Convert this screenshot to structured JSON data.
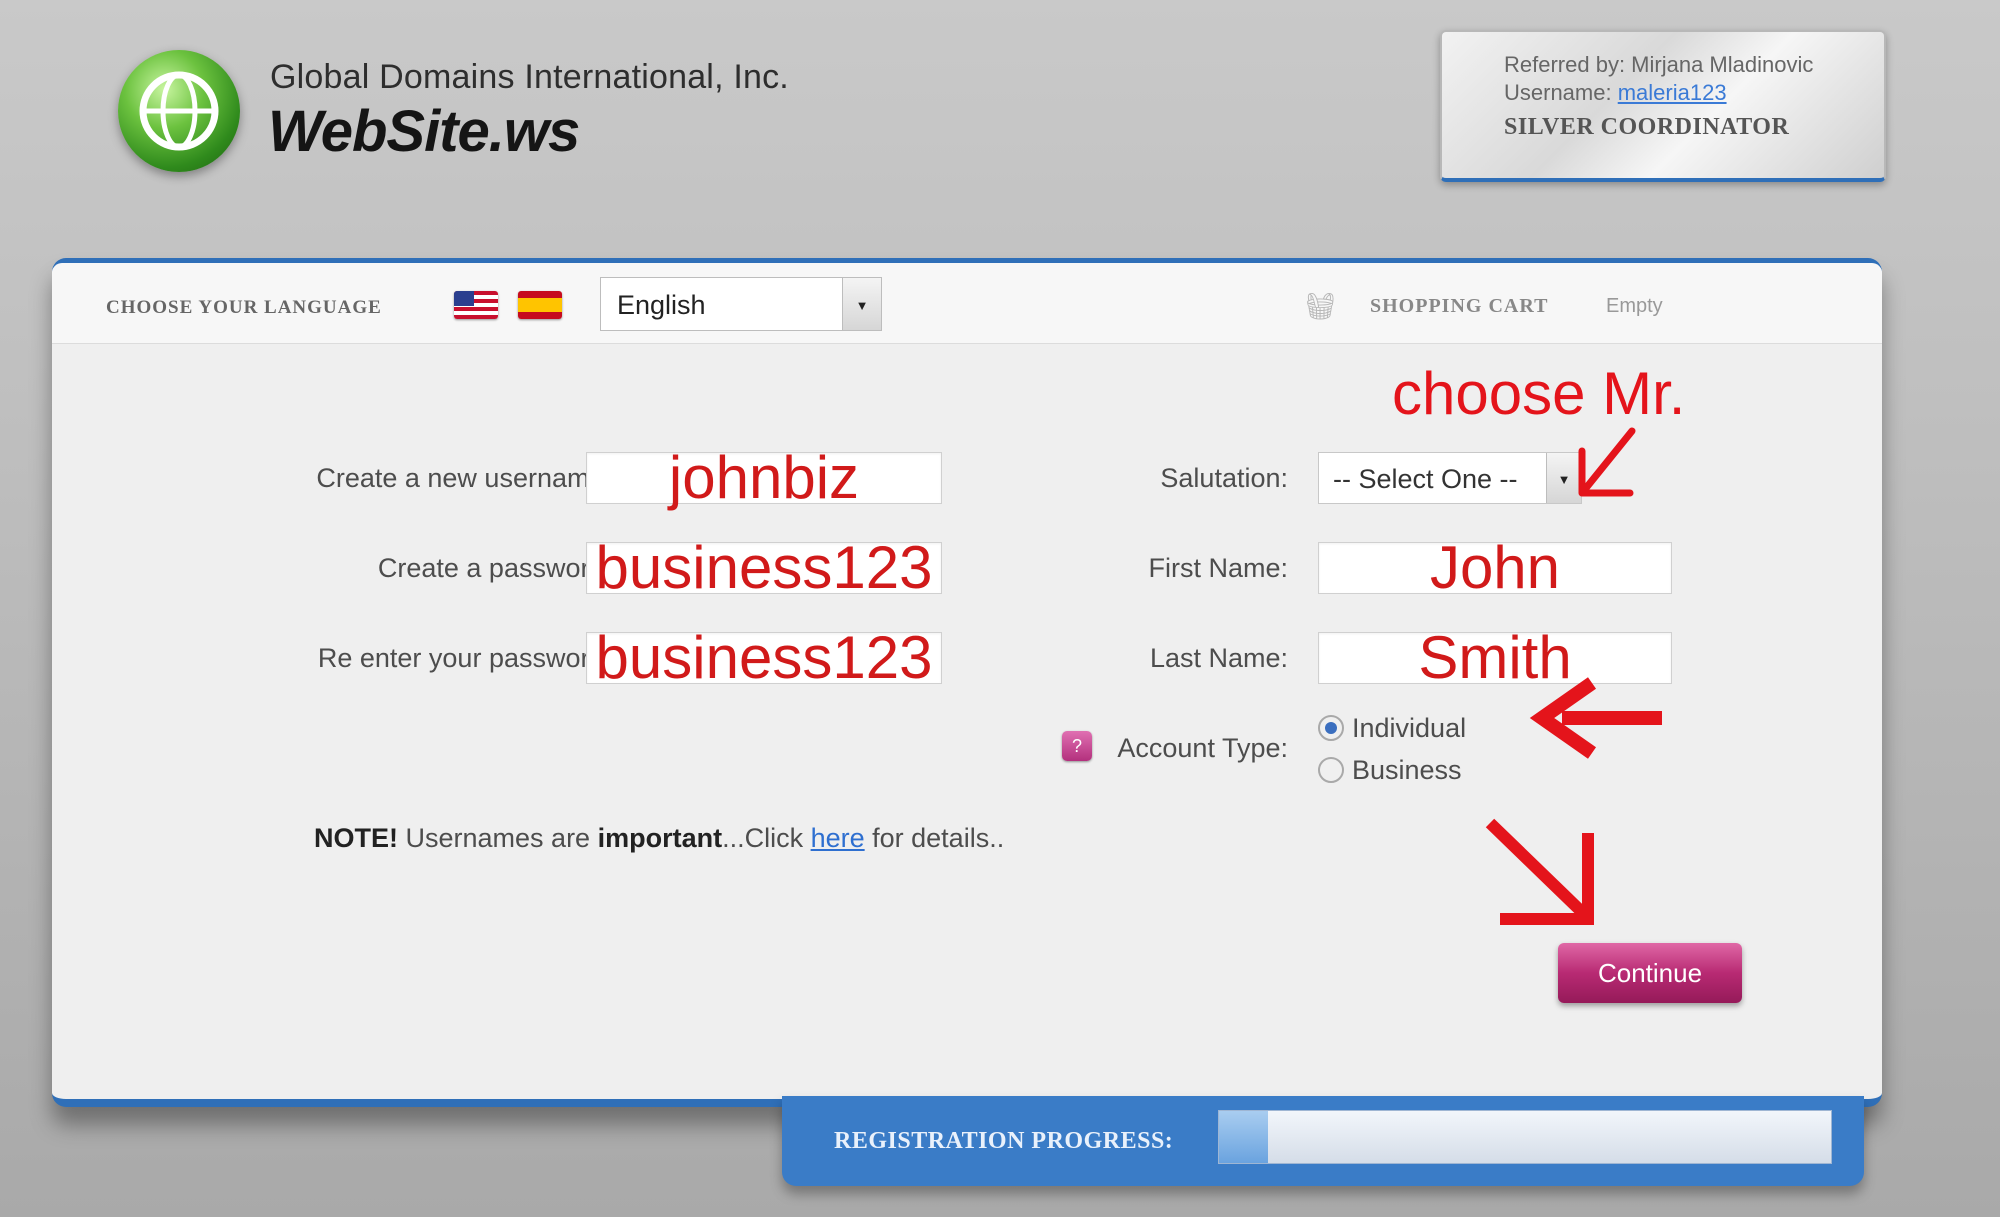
{
  "header": {
    "company": "Global Domains International, Inc.",
    "brand": "WebSite.ws",
    "logo_icon": "globe-icon"
  },
  "referral": {
    "referred_by": "Referred by: Mirjana Mladinovic",
    "username_label": "Username: ",
    "username_value": "maleria123",
    "rank": "SILVER COORDINATOR"
  },
  "topbar": {
    "language_label": "CHOOSE YOUR LANGUAGE",
    "flags": [
      "us-flag-icon",
      "spain-flag-icon"
    ],
    "language_value": "English",
    "cart_label": "SHOPPING CART",
    "cart_status": "Empty",
    "cart_icon": "basket-icon"
  },
  "form": {
    "username_label": "Create a new username:",
    "username_value": "johnbiz",
    "password_label": "Create a password:",
    "password_value": "business123",
    "reenter_label": "Re enter your password:",
    "reenter_value": "business123",
    "salutation_label": "Salutation:",
    "salutation_value": "-- Select One --",
    "first_name_label": "First Name:",
    "first_name_value": "John",
    "last_name_label": "Last Name:",
    "last_name_value": "Smith",
    "account_type_label": "Account Type:",
    "account_options": [
      "Individual",
      "Business"
    ],
    "account_selected": "Individual",
    "help_icon_glyph": "?",
    "note_prefix": "NOTE!",
    "note_mid1": " Usernames are ",
    "note_bold": "important",
    "note_mid2": "...Click ",
    "note_link": "here",
    "note_suffix": " for details..",
    "continue_label": "Continue"
  },
  "annotation": {
    "text": "choose Mr.",
    "color": "#e4141b"
  },
  "progress": {
    "label": "REGISTRATION PROGRESS:",
    "fraction": 0.08
  },
  "colors": {
    "accent_blue": "#2f6fb8",
    "continue_pink": "#b82a73"
  }
}
